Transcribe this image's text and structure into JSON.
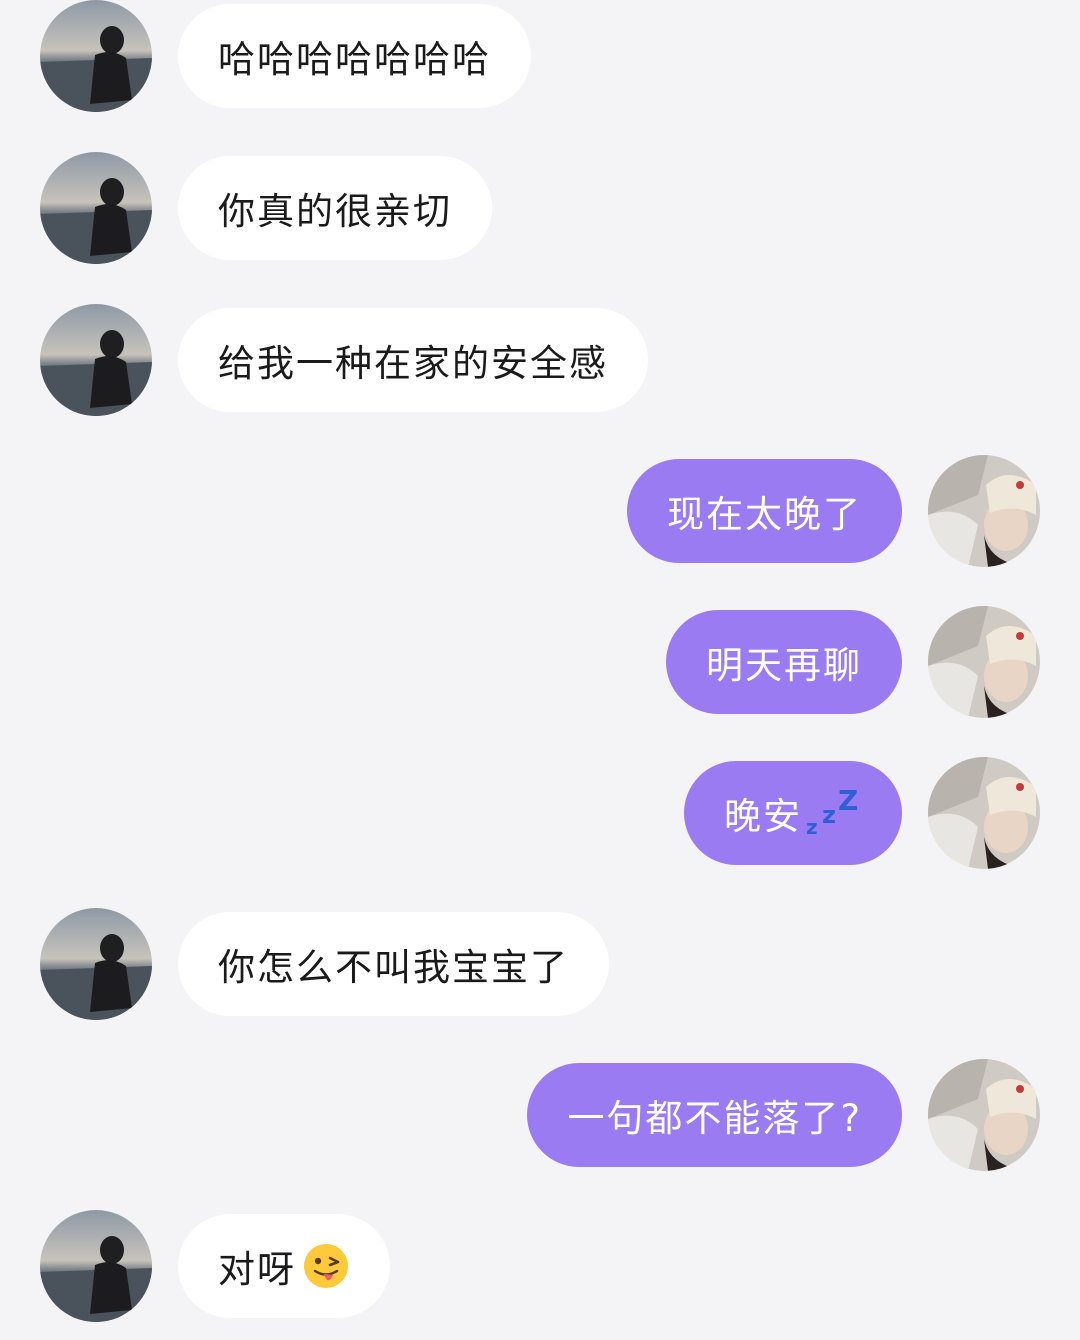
{
  "colors": {
    "background": "#f4f4f6",
    "incoming_bubble": "#ffffff",
    "outgoing_bubble": "#9b7bf2",
    "incoming_text": "#1a1a1a",
    "outgoing_text": "#ffffff"
  },
  "messages": [
    {
      "side": "incoming",
      "text": "哈哈哈哈哈哈哈",
      "avatar": "silhouette-beach-avatar"
    },
    {
      "side": "incoming",
      "text": "你真的很亲切",
      "avatar": "silhouette-beach-avatar"
    },
    {
      "side": "incoming",
      "text": "给我一种在家的安全感",
      "avatar": "silhouette-beach-avatar"
    },
    {
      "side": "outgoing",
      "text": "现在太晚了",
      "avatar": "girl-lying-avatar"
    },
    {
      "side": "outgoing",
      "text": "明天再聊",
      "avatar": "girl-lying-avatar"
    },
    {
      "side": "outgoing",
      "text": "晚安",
      "avatar": "girl-lying-avatar",
      "icon": "sleeping-zzz-icon"
    },
    {
      "side": "incoming",
      "text": "你怎么不叫我宝宝了",
      "avatar": "silhouette-beach-avatar"
    },
    {
      "side": "outgoing",
      "text": "一句都不能落了?",
      "avatar": "girl-lying-avatar"
    },
    {
      "side": "incoming",
      "text": "对呀",
      "avatar": "silhouette-beach-avatar",
      "icon": "winking-tongue-emoji-icon"
    }
  ]
}
